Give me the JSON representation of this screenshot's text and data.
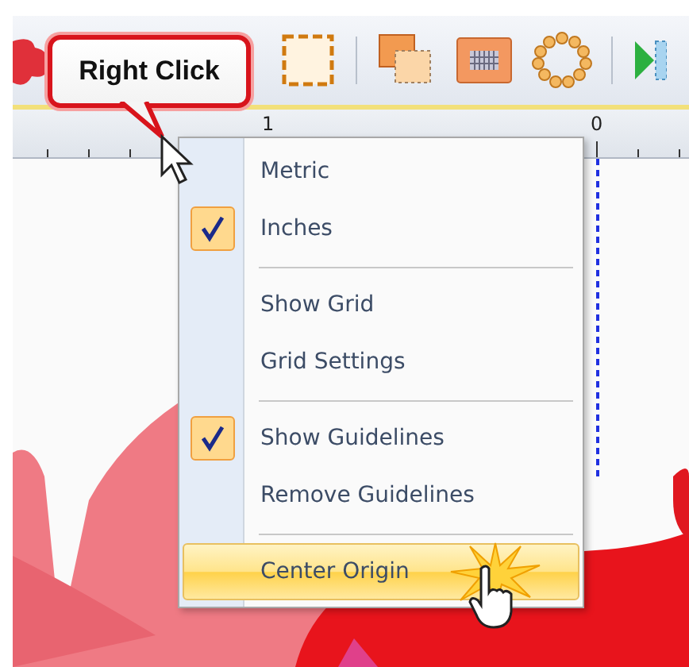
{
  "callout": {
    "text": "Right Click"
  },
  "ruler": {
    "labels": [
      "1",
      "0"
    ]
  },
  "context_menu": {
    "items": [
      {
        "kind": "item",
        "label": "Metric",
        "checked": false,
        "selected": false
      },
      {
        "kind": "item",
        "label": "Inches",
        "checked": true,
        "selected": false
      },
      {
        "kind": "separator"
      },
      {
        "kind": "item",
        "label": "Show Grid",
        "checked": false,
        "selected": false
      },
      {
        "kind": "item",
        "label": "Grid Settings",
        "checked": false,
        "selected": false
      },
      {
        "kind": "separator"
      },
      {
        "kind": "item",
        "label": "Show Guidelines",
        "checked": true,
        "selected": false
      },
      {
        "kind": "item",
        "label": "Remove Guidelines",
        "checked": false,
        "selected": false
      },
      {
        "kind": "separator"
      },
      {
        "kind": "item",
        "label": "Center Origin",
        "checked": false,
        "selected": true
      }
    ]
  }
}
